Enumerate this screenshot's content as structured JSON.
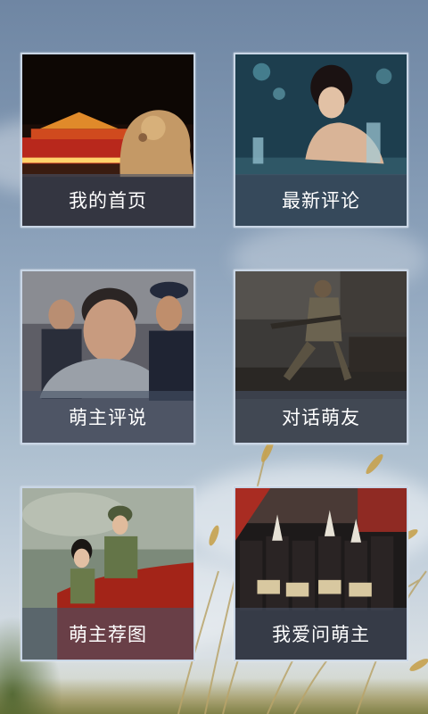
{
  "menu": {
    "tiles": [
      {
        "label": "我的首页"
      },
      {
        "label": "最新评论"
      },
      {
        "label": "萌主评说"
      },
      {
        "label": "对话萌友"
      },
      {
        "label": "萌主荐图"
      },
      {
        "label": "我爱问萌主"
      }
    ]
  }
}
